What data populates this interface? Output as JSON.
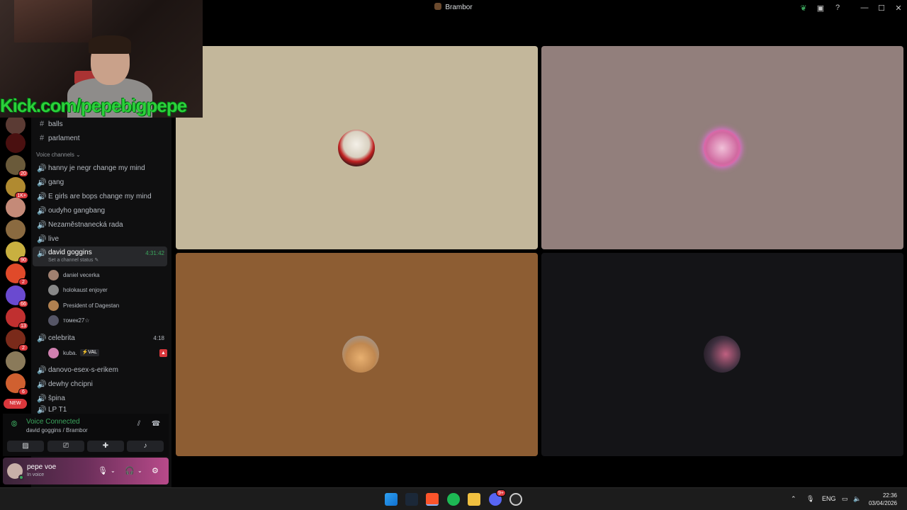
{
  "window": {
    "title": "Brambor"
  },
  "overlay": {
    "kick_text": "Kick.com/pepebigpepe"
  },
  "guild_badges": {
    "g3": "20",
    "g4": "1K+",
    "g7": "90",
    "g8": "2",
    "g9": "66",
    "g10": "13",
    "g11": "2",
    "g13": "6",
    "new_label": "NEW"
  },
  "channels": {
    "text": [
      "balls",
      "parlament"
    ],
    "voice_category": "Voice channels",
    "voice": [
      "hanny je negr change my mind",
      "gang",
      "E girls are bops change my mind",
      "oudyho gangbang",
      "Nezaměstnanecká rada",
      "live"
    ],
    "active": {
      "name": "david goggins",
      "time": "4:31:42",
      "status": "Set a channel status"
    },
    "members": [
      "daniel vecerka",
      "holokaust enjoyer",
      "President of Dagestan",
      "томек27☆"
    ],
    "celebrita": {
      "name": "celebrita",
      "time": "4:18",
      "member": "kuba.",
      "member_tag": "⚡VAL"
    },
    "more": [
      "danovo-esex-s-erikem",
      "dewhy chcipni",
      "špina",
      "LP T1"
    ]
  },
  "voice_panel": {
    "status": "Voice Connected",
    "sub": "david goggins / Brambor"
  },
  "user_panel": {
    "name": "pepe voe",
    "sub": "In voice"
  },
  "taskbar": {
    "lang": "ENG",
    "time": "22:36",
    "date": "03/04/2026",
    "discord_badge": "9+"
  },
  "colors": {
    "accent_green": "#3ba55d",
    "tile1": "#c3b79b",
    "tile2": "#927f7c",
    "tile3": "#8d5d33",
    "tile4": "#141417"
  }
}
